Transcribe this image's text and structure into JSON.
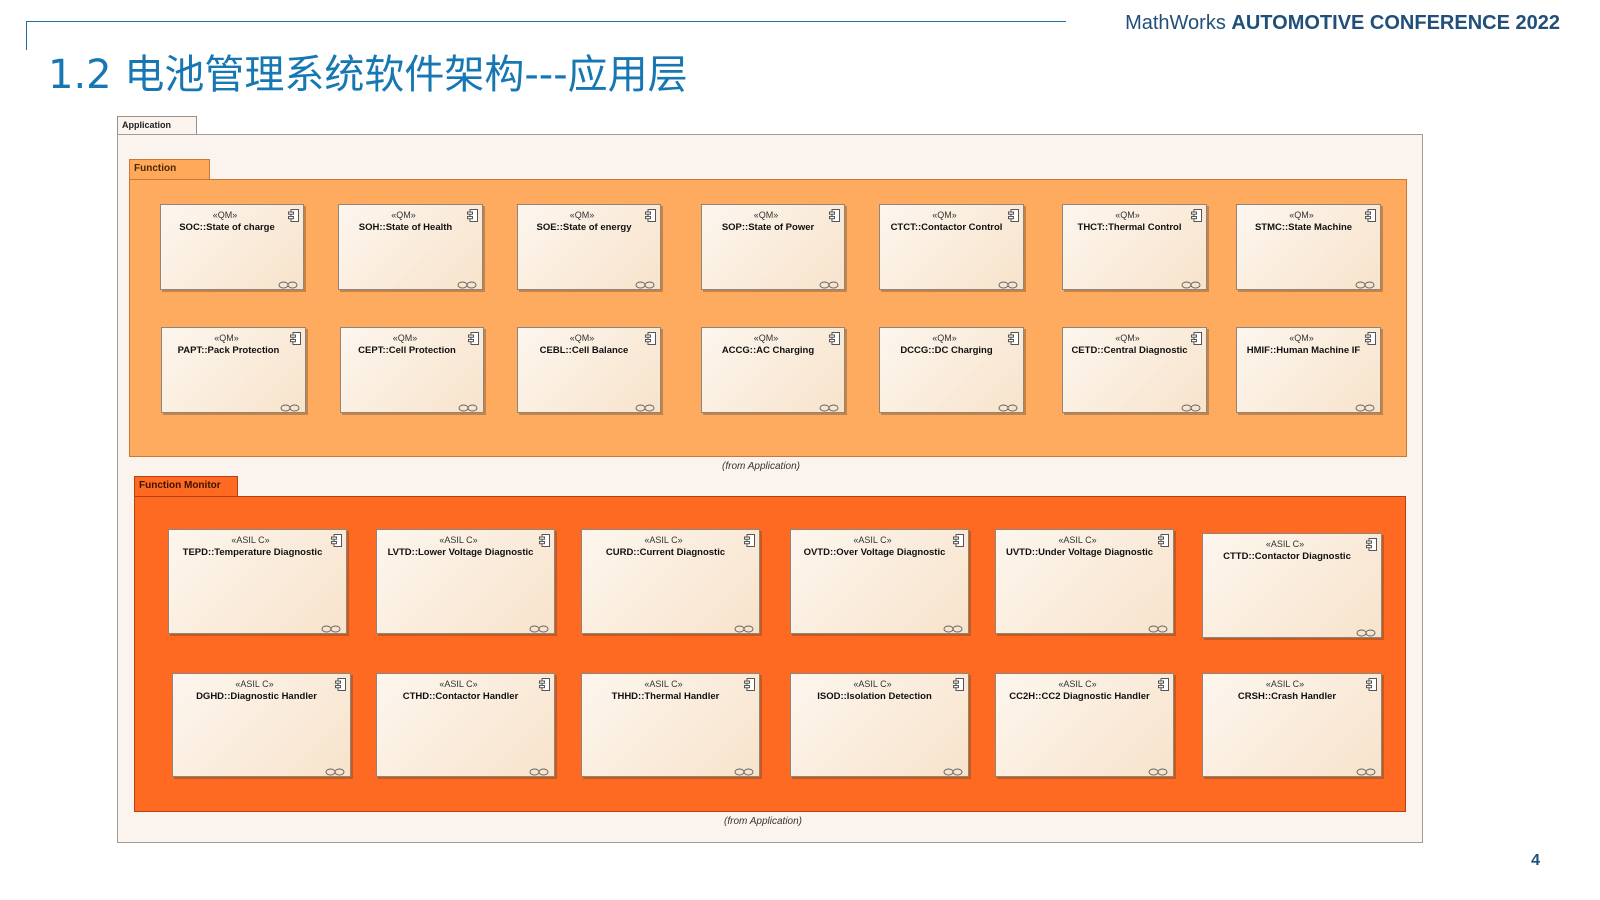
{
  "header": {
    "brand": "MathWorks",
    "conference": "AUTOMOTIVE CONFERENCE 2022",
    "title": "1.2 电池管理系统软件架构---应用层",
    "page_number": "4"
  },
  "diagram": {
    "application_label": "Application",
    "function_package": {
      "label": "Function",
      "from_note": "(from Application)",
      "color": "#ffab5f",
      "components": [
        {
          "stereotype": "«QM»",
          "name": "SOC::State of charge"
        },
        {
          "stereotype": "«QM»",
          "name": "SOH::State of Health"
        },
        {
          "stereotype": "«QM»",
          "name": "SOE::State of energy"
        },
        {
          "stereotype": "«QM»",
          "name": "SOP::State of Power"
        },
        {
          "stereotype": "«QM»",
          "name": "CTCT::Contactor Control"
        },
        {
          "stereotype": "«QM»",
          "name": "THCT::Thermal Control"
        },
        {
          "stereotype": "«QM»",
          "name": "STMC::State Machine"
        },
        {
          "stereotype": "«QM»",
          "name": "PAPT::Pack Protection"
        },
        {
          "stereotype": "«QM»",
          "name": "CEPT::Cell Protection"
        },
        {
          "stereotype": "«QM»",
          "name": "CEBL::Cell Balance"
        },
        {
          "stereotype": "«QM»",
          "name": "ACCG::AC Charging"
        },
        {
          "stereotype": "«QM»",
          "name": "DCCG::DC Charging"
        },
        {
          "stereotype": "«QM»",
          "name": "CETD::Central Diagnostic"
        },
        {
          "stereotype": "«QM»",
          "name": "HMIF::Human Machine IF"
        }
      ]
    },
    "monitor_package": {
      "label": "Function Monitor",
      "from_note": "(from Application)",
      "color": "#ff6a22",
      "components": [
        {
          "stereotype": "«ASIL C»",
          "name": "TEPD::Temperature Diagnostic"
        },
        {
          "stereotype": "«ASIL C»",
          "name": "LVTD::Lower Voltage Diagnostic"
        },
        {
          "stereotype": "«ASIL C»",
          "name": "CURD::Current Diagnostic"
        },
        {
          "stereotype": "«ASIL C»",
          "name": "OVTD::Over Voltage Diagnostic"
        },
        {
          "stereotype": "«ASIL C»",
          "name": "UVTD::Under Voltage Diagnostic"
        },
        {
          "stereotype": "«ASIL C»",
          "name": "CTTD::Contactor Diagnostic"
        },
        {
          "stereotype": "«ASIL C»",
          "name": "DGHD::Diagnostic Handler"
        },
        {
          "stereotype": "«ASIL C»",
          "name": "CTHD::Contactor Handler"
        },
        {
          "stereotype": "«ASIL C»",
          "name": "THHD::Thermal Handler"
        },
        {
          "stereotype": "«ASIL C»",
          "name": "ISOD::Isolation Detection"
        },
        {
          "stereotype": "«ASIL C»",
          "name": "CC2H::CC2 Diagnostic Handler"
        },
        {
          "stereotype": "«ASIL C»",
          "name": "CRSH::Crash Handler"
        }
      ]
    }
  }
}
